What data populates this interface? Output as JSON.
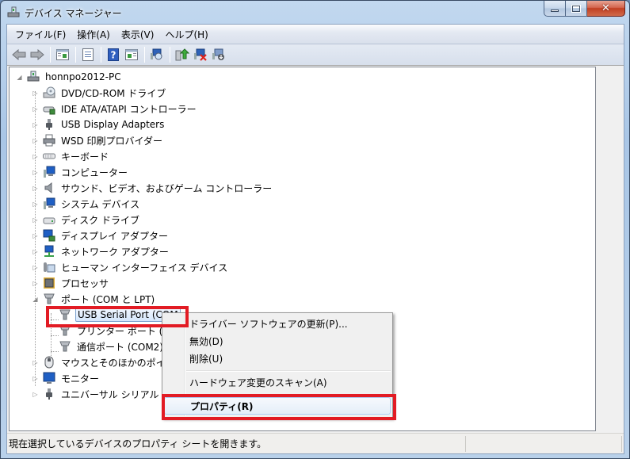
{
  "window": {
    "title": "デバイス マネージャー",
    "icon": "device-manager-icon",
    "caption_buttons": {
      "minimize": "minimize",
      "maximize": "maximize",
      "close": "✕"
    }
  },
  "menubar": [
    {
      "label": "ファイル(F)"
    },
    {
      "label": "操作(A)"
    },
    {
      "label": "表示(V)"
    },
    {
      "label": "ヘルプ(H)"
    }
  ],
  "toolbar": [
    {
      "icon": "back-arrow-icon"
    },
    {
      "icon": "forward-arrow-icon"
    },
    {
      "icon": "show-hide-console-tree-icon"
    },
    {
      "icon": "properties-icon"
    },
    {
      "icon": "help-icon"
    },
    {
      "icon": "show-action-pane-icon"
    },
    {
      "icon": "scan-hardware-icon"
    },
    {
      "icon": "update-driver-icon"
    },
    {
      "icon": "uninstall-device-icon"
    },
    {
      "icon": "disable-device-icon"
    }
  ],
  "tree": {
    "root": {
      "label": "honnpo2012-PC",
      "icon": "computer-icon",
      "expanded": true
    },
    "categories": [
      {
        "label": "DVD/CD-ROM ドライブ",
        "icon": "dvd-drive-icon"
      },
      {
        "label": "IDE ATA/ATAPI コントローラー",
        "icon": "ide-controller-icon"
      },
      {
        "label": "USB Display Adapters",
        "icon": "usb-plug-icon"
      },
      {
        "label": "WSD 印刷プロバイダー",
        "icon": "printer-icon"
      },
      {
        "label": "キーボード",
        "icon": "keyboard-icon"
      },
      {
        "label": "コンピューター",
        "icon": "computer-monitor-icon"
      },
      {
        "label": "サウンド、ビデオ、およびゲーム コントローラー",
        "icon": "speaker-icon"
      },
      {
        "label": "システム デバイス",
        "icon": "system-device-icon"
      },
      {
        "label": "ディスク ドライブ",
        "icon": "disk-drive-icon"
      },
      {
        "label": "ディスプレイ アダプター",
        "icon": "display-adapter-icon"
      },
      {
        "label": "ネットワーク アダプター",
        "icon": "network-adapter-icon"
      },
      {
        "label": "ヒューマン インターフェイス デバイス",
        "icon": "hid-icon"
      },
      {
        "label": "プロセッサ",
        "icon": "processor-icon"
      },
      {
        "label": "ポート (COM と LPT)",
        "icon": "port-icon",
        "expanded": true,
        "children": [
          {
            "label": "USB Serial Port (COM",
            "icon": "port-icon",
            "selected": true
          },
          {
            "label": "プリンター ポート (L",
            "icon": "port-icon"
          },
          {
            "label": "通信ポート (COM2)",
            "icon": "port-icon"
          }
        ]
      },
      {
        "label": "マウスとそのほかのポイ",
        "icon": "mouse-icon"
      },
      {
        "label": "モニター",
        "icon": "monitor-icon"
      },
      {
        "label": "ユニバーサル シリアル ",
        "icon": "usb-plug-icon"
      }
    ]
  },
  "context_menu": {
    "items": [
      {
        "label": "ドライバー ソフトウェアの更新(P)..."
      },
      {
        "label": "無効(D)"
      },
      {
        "label": "削除(U)"
      },
      {
        "separator": true
      },
      {
        "label": "ハードウェア変更のスキャン(A)"
      },
      {
        "separator": true
      },
      {
        "label": "プロパティ(R)",
        "bold": true,
        "hovered": true
      }
    ]
  },
  "statusbar": {
    "text": "現在選択しているデバイスのプロパティ シートを開きます。"
  },
  "annotations": {
    "highlight_color": "#e21b24"
  }
}
